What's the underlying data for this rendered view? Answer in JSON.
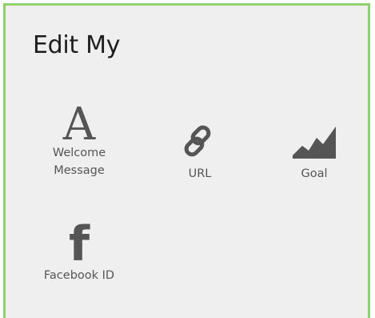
{
  "header": {
    "title": "Edit My"
  },
  "tiles": [
    {
      "label": "Welcome Message",
      "label_line1": "Welcome",
      "label_line2": "Message",
      "icon": "text-a-icon",
      "glyph": "A"
    },
    {
      "label": "URL",
      "icon": "link-icon"
    },
    {
      "label": "Goal",
      "icon": "chart-area-icon"
    },
    {
      "label": "Facebook ID",
      "icon": "facebook-icon",
      "glyph": "f"
    }
  ],
  "colors": {
    "border_accent": "#8fd16a",
    "panel_bg": "#efefef",
    "icon": "#555555",
    "title_text": "#1e1e1e"
  }
}
